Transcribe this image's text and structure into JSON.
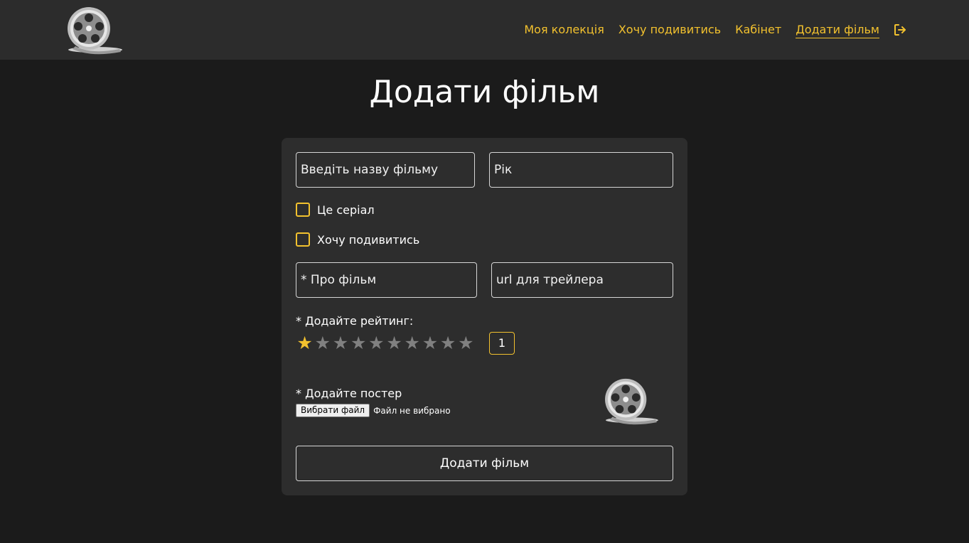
{
  "header": {
    "logo_icon": "film-reel-icon",
    "nav": [
      {
        "label": "Моя колекція"
      },
      {
        "label": "Хочу подивитись"
      },
      {
        "label": "Кабінет"
      },
      {
        "label": "Додати фільм",
        "active": true
      }
    ],
    "logout_icon": "logout-icon",
    "accent_color": "#f2c12e"
  },
  "page": {
    "title": "Додати фільм"
  },
  "form": {
    "title_placeholder": "Введіть назву фільму",
    "year_placeholder": "Рік",
    "series_label": "Це серіал",
    "want_label": "Хочу подивитись",
    "about_placeholder": "* Про фільм",
    "trailer_placeholder": "url для трейлера",
    "rating_label": "* Додайте рейтинг:",
    "rating": {
      "value": "1",
      "max": 10
    },
    "poster_label": "* Додайте постер",
    "file_button": "Вибрати файл",
    "file_status": "Файл не вибрано",
    "poster_preview_icon": "film-reel-icon",
    "submit_label": "Додати фільм"
  }
}
